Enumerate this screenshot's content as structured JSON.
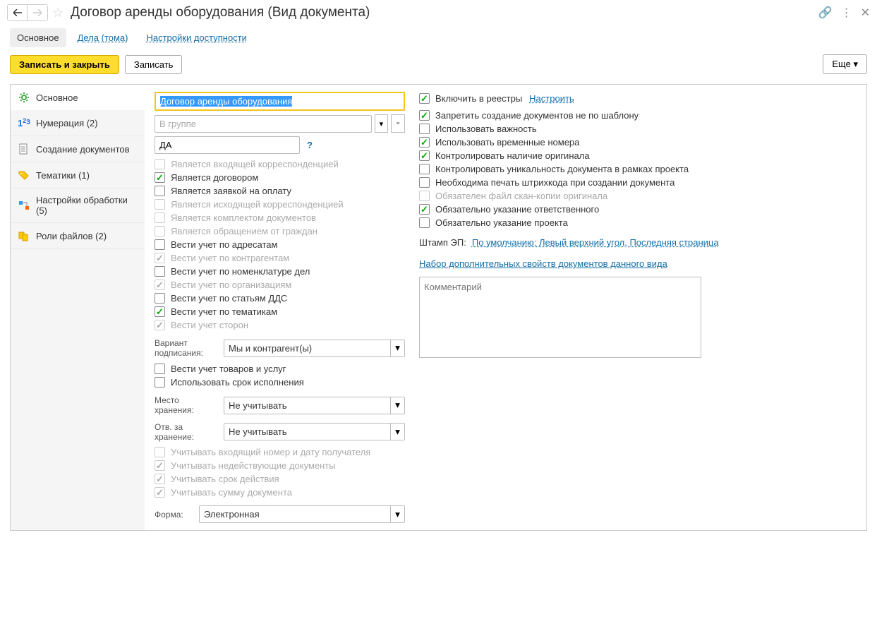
{
  "title": "Договор аренды оборудования (Вид документа)",
  "tabs": {
    "main": "Основное",
    "files": "Дела (тома)",
    "access": "Настройки доступности"
  },
  "toolbar": {
    "save_close": "Записать и закрыть",
    "save": "Записать",
    "more": "Еще"
  },
  "sidebar": [
    {
      "label": "Основное",
      "icon": "gear"
    },
    {
      "label": "Нумерация (2)",
      "icon": "num"
    },
    {
      "label": "Создание документов",
      "icon": "doc"
    },
    {
      "label": "Тематики (1)",
      "icon": "tag"
    },
    {
      "label": "Настройки обработки (5)",
      "icon": "flow"
    },
    {
      "label": "Роли файлов (2)",
      "icon": "roles"
    }
  ],
  "fields": {
    "name_value": "Договор аренды оборудования",
    "group_placeholder": "В группе",
    "code_value": "ДА",
    "variant_label": "Вариант подписания:",
    "variant_value": "Мы и контрагент(ы)",
    "storage_label": "Место хранения:",
    "storage_value": "Не учитывать",
    "resp_label": "Отв. за хранение:",
    "resp_value": "Не учитывать",
    "form_label": "Форма:",
    "form_value": "Электронная",
    "stamp_label": "Штамп ЭП:",
    "stamp_value": "По умолчанию: Левый верхний угол, Последняя страница",
    "extra_props": "Набор дополнительных свойств документов данного вида",
    "comment_placeholder": "Комментарий",
    "include_registry": "Включить в реестры",
    "configure": "Настроить"
  },
  "left_checks": [
    {
      "label": "Является входящей корреспонденцией",
      "checked": false,
      "disabled": true
    },
    {
      "label": "Является договором",
      "checked": true,
      "disabled": false
    },
    {
      "label": "Является заявкой на оплату",
      "checked": false,
      "disabled": false
    },
    {
      "label": "Является исходящей корреспонденцией",
      "checked": false,
      "disabled": true
    },
    {
      "label": "Является комплектом документов",
      "checked": false,
      "disabled": true
    },
    {
      "label": "Является обращением от граждан",
      "checked": false,
      "disabled": true
    },
    {
      "label": "Вести учет по адресатам",
      "checked": false,
      "disabled": false
    },
    {
      "label": "Вести учет по контрагентам",
      "checked": true,
      "disabled": true
    },
    {
      "label": "Вести учет по номенклатуре дел",
      "checked": false,
      "disabled": false
    },
    {
      "label": "Вести учет по организациям",
      "checked": true,
      "disabled": true
    },
    {
      "label": "Вести учет по статьям ДДС",
      "checked": false,
      "disabled": false
    },
    {
      "label": "Вести учет по тематикам",
      "checked": true,
      "disabled": false
    },
    {
      "label": "Вести учет сторон",
      "checked": true,
      "disabled": true
    }
  ],
  "left_checks2": [
    {
      "label": "Вести учет товаров и услуг",
      "checked": false,
      "disabled": false
    },
    {
      "label": "Использовать срок исполнения",
      "checked": false,
      "disabled": false
    }
  ],
  "left_checks3": [
    {
      "label": "Учитывать входящий номер и дату получателя",
      "checked": false,
      "disabled": true
    },
    {
      "label": "Учитывать недействующие документы",
      "checked": true,
      "disabled": true
    },
    {
      "label": "Учитывать срок действия",
      "checked": true,
      "disabled": true
    },
    {
      "label": "Учитывать сумму документа",
      "checked": true,
      "disabled": true
    }
  ],
  "right_checks": [
    {
      "label": "Запретить создание документов не по шаблону",
      "checked": true,
      "disabled": false
    },
    {
      "label": "Использовать важность",
      "checked": false,
      "disabled": false
    },
    {
      "label": "Использовать временные номера",
      "checked": true,
      "disabled": false
    },
    {
      "label": "Контролировать наличие оригинала",
      "checked": true,
      "disabled": false
    },
    {
      "label": "Контролировать уникальность документа в рамках проекта",
      "checked": false,
      "disabled": false
    },
    {
      "label": "Необходима печать штрихкода при создании документа",
      "checked": false,
      "disabled": false
    },
    {
      "label": "Обязателен файл скан-копии оригинала",
      "checked": false,
      "disabled": true
    },
    {
      "label": "Обязательно указание ответственного",
      "checked": true,
      "disabled": false
    },
    {
      "label": "Обязательно указание проекта",
      "checked": false,
      "disabled": false
    }
  ]
}
